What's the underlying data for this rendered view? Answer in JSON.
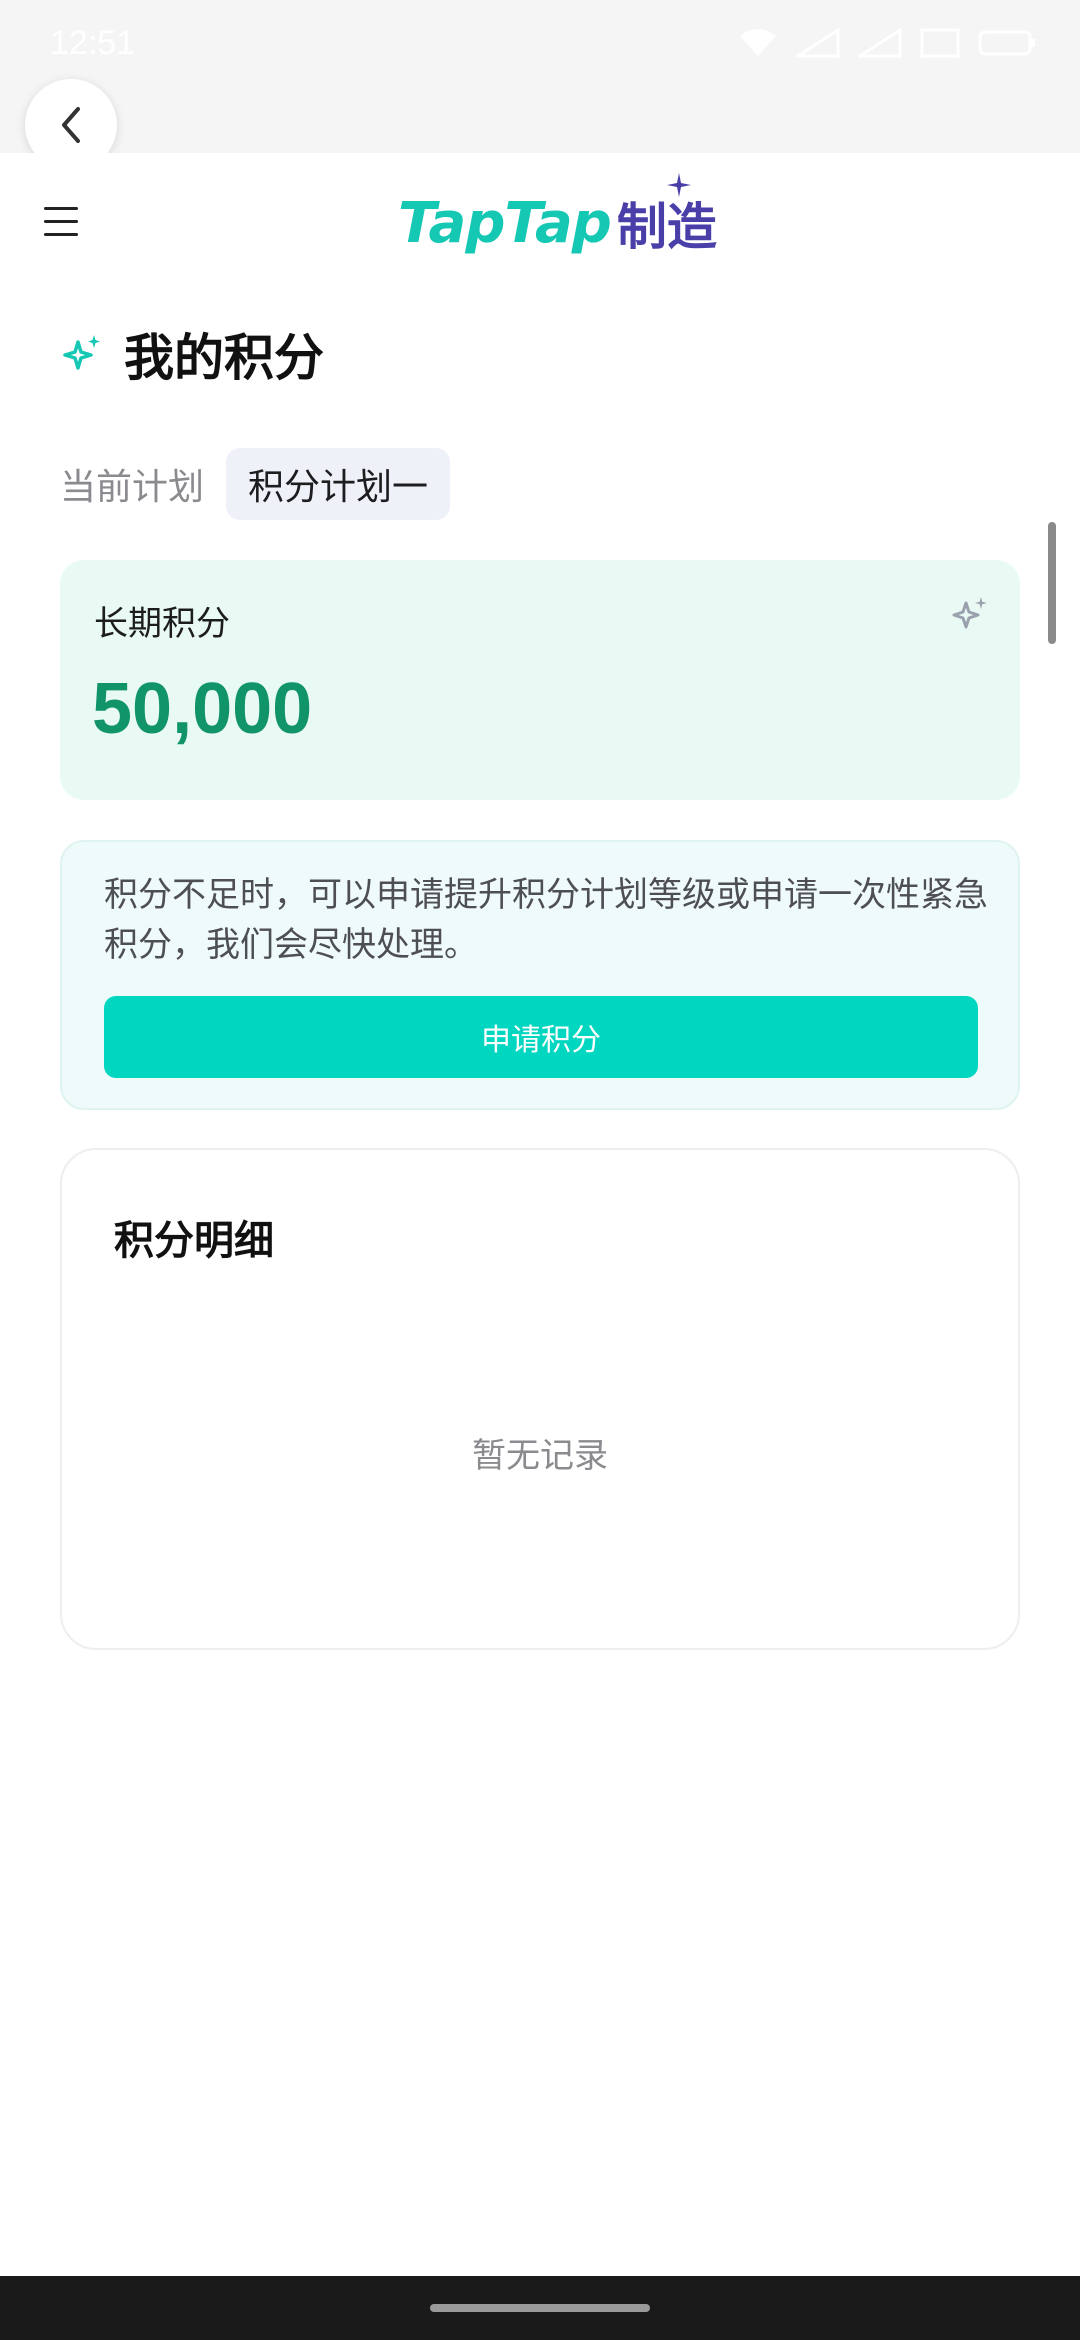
{
  "status_bar": {
    "time": "12:51"
  },
  "header": {
    "logo_tap": "TapTap",
    "logo_cn": "制造"
  },
  "page": {
    "title": "我的积分",
    "plan_label": "当前计划",
    "plan_value": "积分计划一"
  },
  "points_card": {
    "label": "长期积分",
    "value": "50,000"
  },
  "notice": {
    "text": "积分不足时，可以申请提升积分计划等级或申请一次性紧急积分，我们会尽快处理。",
    "button_label": "申请积分"
  },
  "details": {
    "title": "积分明细",
    "empty_text": "暂无记录"
  },
  "colors": {
    "accent": "#00d6c0",
    "points_green": "#12946a",
    "logo_teal": "#14c8b4",
    "logo_purple": "#4a3fa8"
  }
}
